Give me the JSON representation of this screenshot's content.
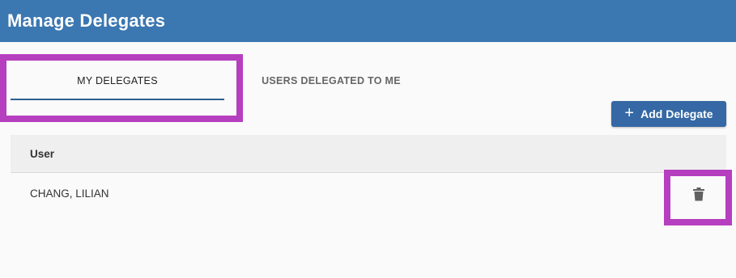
{
  "header": {
    "title": "Manage Delegates"
  },
  "tabs": [
    {
      "label": "MY DELEGATES",
      "active": true
    },
    {
      "label": "USERS DELEGATED TO ME",
      "active": false
    }
  ],
  "toolbar": {
    "add_label": "Add Delegate",
    "add_icon": "plus-icon"
  },
  "table": {
    "columns": [
      "User"
    ],
    "rows": [
      {
        "user": "CHANG, LILIAN",
        "action_icon": "trash-icon"
      }
    ]
  },
  "colors": {
    "header_bg": "#3b77b0",
    "button_bg": "#3568a4",
    "highlight": "#b53fbe",
    "tab_underline": "#2d5f8f"
  }
}
